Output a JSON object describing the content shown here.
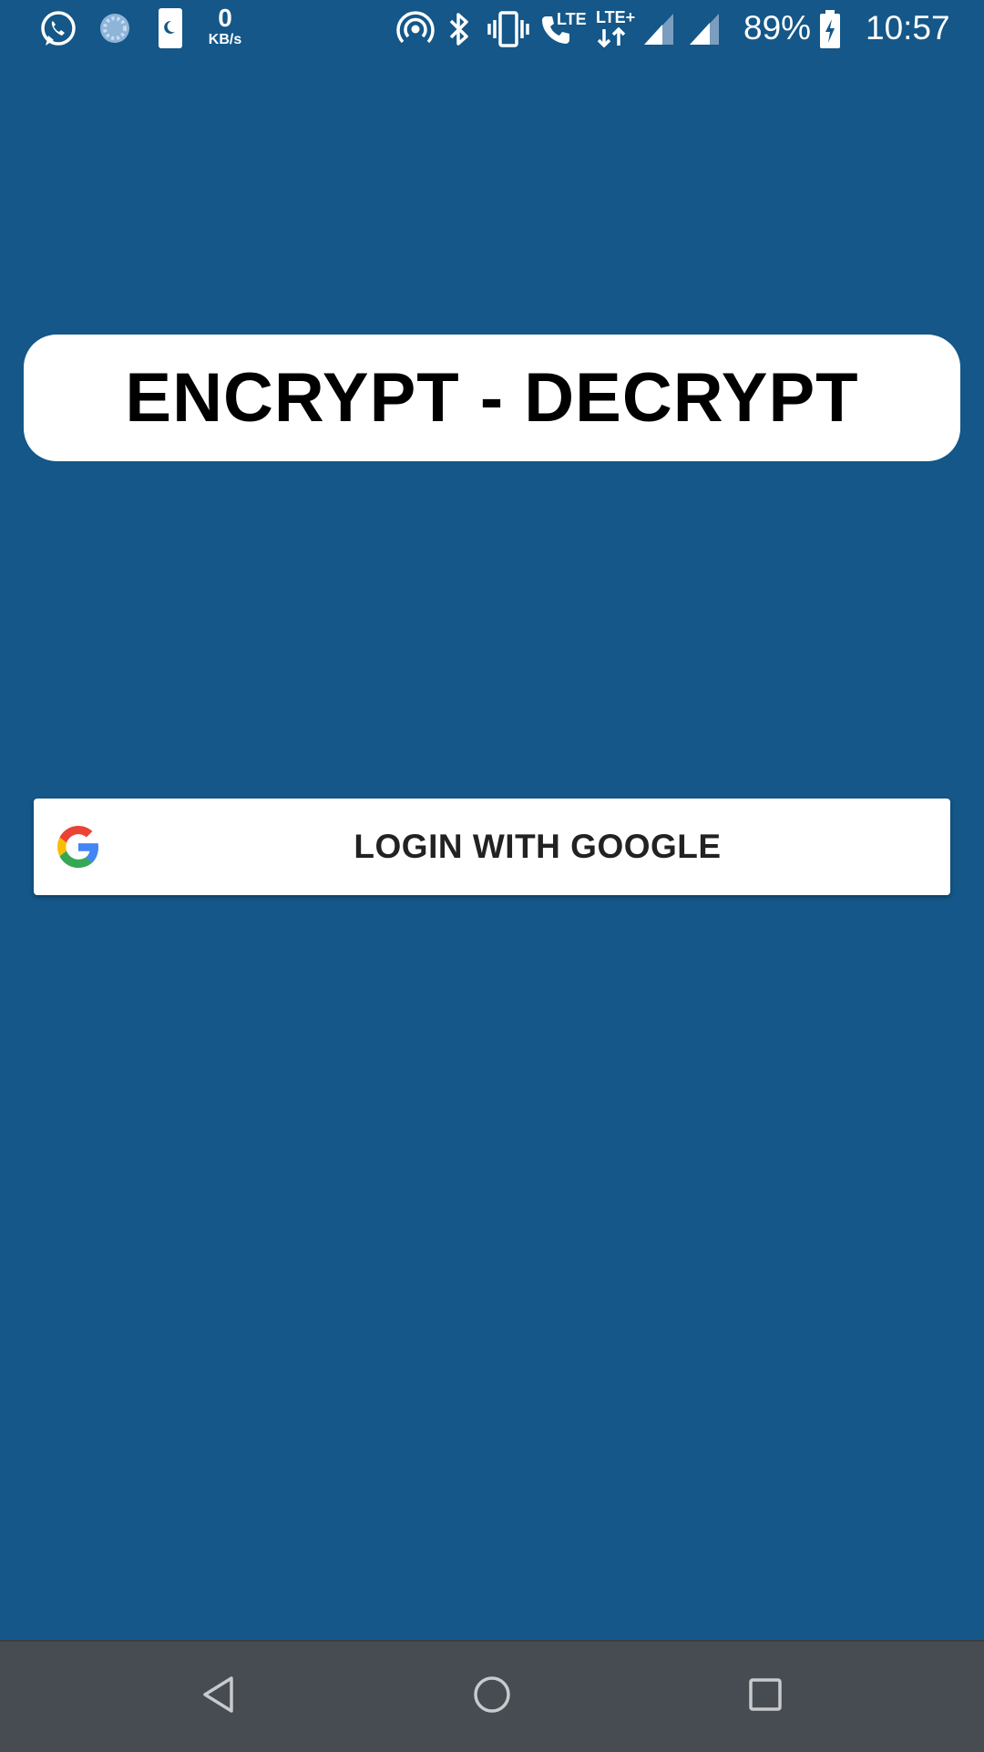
{
  "status_bar": {
    "net_speed_value": "0",
    "net_speed_unit": "KB/s",
    "lte_label_1": "LTE",
    "lte_label_2": "LTE+",
    "battery_percent": "89%",
    "time": "10:57",
    "icons": [
      "whatsapp-icon",
      "loading-icon",
      "sim-card-icon",
      "hotspot-icon",
      "bluetooth-icon",
      "vibrate-icon",
      "volte-call-icon",
      "lte-data-icon",
      "signal-icon",
      "signal-icon",
      "battery-charging-icon"
    ]
  },
  "main": {
    "title": "ENCRYPT - DECRYPT",
    "login_button_label": "LOGIN WITH GOOGLE"
  },
  "nav_bar": {
    "buttons": [
      "back-icon",
      "home-icon",
      "recents-icon"
    ]
  },
  "colors": {
    "background": "#145788",
    "nav_bar": "#464c52",
    "card": "#ffffff",
    "google_blue": "#4285F4",
    "google_red": "#EA4335",
    "google_yellow": "#FBBC05",
    "google_green": "#34A853"
  }
}
